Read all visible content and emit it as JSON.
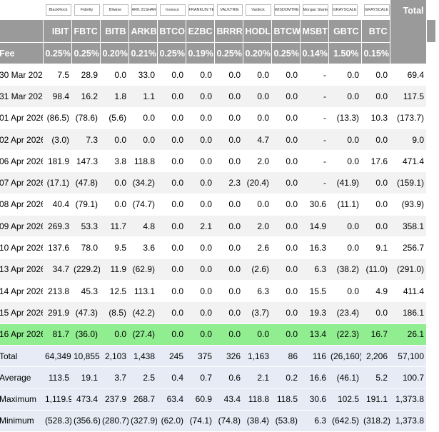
{
  "table": {
    "logos": [
      {
        "name": "blackrock-logo",
        "text": "BlackRock"
      },
      {
        "name": "fidelity-logo",
        "text": "Fidelity"
      },
      {
        "name": "bitwise-logo",
        "text": "Bitwise"
      },
      {
        "name": "ark-logo",
        "text": "ARK 21SHARES"
      },
      {
        "name": "invesco-logo",
        "text": "Invesco"
      },
      {
        "name": "franklin-logo",
        "text": "FRANKLIN TEMPLETON"
      },
      {
        "name": "valkyrie-logo",
        "text": "VALKYRIE"
      },
      {
        "name": "vaneck-logo",
        "text": "VanEck"
      },
      {
        "name": "wisdomtree-logo",
        "text": "WISDOMTREE"
      },
      {
        "name": "morgan-stanley-logo",
        "text": "Morgan Stanley"
      },
      {
        "name": "grayscale-logo-1",
        "text": "GRAYSCALE"
      },
      {
        "name": "grayscale-logo-2",
        "text": "GRAYSCALE"
      }
    ],
    "total_header": "Total",
    "tickers": [
      "IBIT",
      "FBTC",
      "BITB",
      "ARKB",
      "BTCO",
      "EZBC",
      "BRRR",
      "HODL",
      "BTCW",
      "MSBT",
      "GBTC",
      "BTC"
    ],
    "fee_label": "Fee",
    "fees": [
      "0.25%",
      "0.25%",
      "0.20%",
      "0.21%",
      "0.25%",
      "0.19%",
      "0.25%",
      "0.20%",
      "0.25%",
      "0.14%",
      "1.50%",
      "0.15%"
    ],
    "rows": [
      {
        "date": "30 Mar 2026",
        "values": [
          "7.5",
          "28.9",
          "0.0",
          "33.0",
          "0.0",
          "0.0",
          "0.0",
          "0.0",
          "0.0",
          "-",
          "0.0",
          "0.0"
        ],
        "total": "69.4"
      },
      {
        "date": "31 Mar 2026",
        "values": [
          "98.4",
          "16.2",
          "1.8",
          "1.1",
          "0.0",
          "0.0",
          "0.0",
          "0.0",
          "0.0",
          "-",
          "0.0",
          "0.0"
        ],
        "total": "117.5"
      },
      {
        "date": "01 Apr 2026",
        "values": [
          "(86.5)",
          "(78.6)",
          "(5.6)",
          "0.0",
          "0.0",
          "0.0",
          "0.0",
          "0.0",
          "0.0",
          "-",
          "(13.3)",
          "10.3"
        ],
        "total": "(173.7)"
      },
      {
        "date": "02 Apr 2026",
        "values": [
          "(3.0)",
          "7.3",
          "0.0",
          "0.0",
          "0.0",
          "0.0",
          "0.0",
          "4.7",
          "0.0",
          "-",
          "0.0",
          "0.0"
        ],
        "total": "9.0"
      },
      {
        "date": "06 Apr 2026",
        "values": [
          "181.9",
          "147.3",
          "3.8",
          "118.8",
          "0.0",
          "0.0",
          "0.0",
          "2.0",
          "0.0",
          "-",
          "0.0",
          "17.6"
        ],
        "total": "471.4"
      },
      {
        "date": "07 Apr 2026",
        "values": [
          "(17.1)",
          "(47.8)",
          "0.0",
          "(34.2)",
          "0.0",
          "0.0",
          "2.3",
          "(20.4)",
          "0.0",
          "-",
          "(41.9)",
          "0.0"
        ],
        "total": "(159.1)"
      },
      {
        "date": "08 Apr 2026",
        "values": [
          "40.4",
          "(79.1)",
          "0.0",
          "(74.7)",
          "0.0",
          "0.0",
          "0.0",
          "0.0",
          "0.0",
          "30.6",
          "(11.1)",
          "0.0"
        ],
        "total": "(93.9)"
      },
      {
        "date": "09 Apr 2026",
        "values": [
          "269.3",
          "53.3",
          "11.7",
          "4.8",
          "0.0",
          "2.1",
          "0.0",
          "2.0",
          "0.0",
          "14.9",
          "0.0",
          "0.0"
        ],
        "total": "358.1"
      },
      {
        "date": "10 Apr 2026",
        "values": [
          "137.6",
          "78.0",
          "9.5",
          "3.6",
          "0.0",
          "0.0",
          "0.0",
          "2.6",
          "0.0",
          "16.3",
          "0.0",
          "9.1"
        ],
        "total": "256.7"
      },
      {
        "date": "13 Apr 2026",
        "values": [
          "34.7",
          "(229.2)",
          "11.9",
          "(62.9)",
          "0.0",
          "0.0",
          "0.0",
          "(2.6)",
          "0.0",
          "6.3",
          "(38.2)",
          "(11.0)"
        ],
        "total": "(291.0)"
      },
      {
        "date": "14 Apr 2026",
        "values": [
          "213.8",
          "45.3",
          "12.5",
          "113.1",
          "0.0",
          "0.0",
          "0.0",
          "6.3",
          "0.0",
          "15.5",
          "0.0",
          "4.9"
        ],
        "total": "411.4"
      },
      {
        "date": "15 Apr 2026",
        "values": [
          "291.9",
          "(47.3)",
          "(8.5)",
          "(42.2)",
          "0.0",
          "0.0",
          "0.0",
          "(3.7)",
          "0.0",
          "19.3",
          "(23.4)",
          "0.0"
        ],
        "total": "186.1"
      },
      {
        "date": "16 Apr 2026",
        "values": [
          "81.7",
          "(36.0)",
          "0.0",
          "(27.4)",
          "0.0",
          "0.0",
          "0.0",
          "0.0",
          "0.0",
          "13.4",
          "(22.3)",
          "16.7"
        ],
        "total": "26.1",
        "highlight": true
      }
    ],
    "summary": [
      {
        "label": "Total",
        "values": [
          "64,349",
          "10,855",
          "2,103",
          "1,438",
          "245",
          "375",
          "326",
          "1,163",
          "86",
          "116",
          "(26,160)",
          "2,206"
        ],
        "total": "57,100"
      },
      {
        "label": "Average",
        "values": [
          "113.5",
          "19.1",
          "3.7",
          "2.5",
          "0.4",
          "0.7",
          "0.6",
          "2.1",
          "0.2",
          "16.6",
          "(46.1)",
          "5.2"
        ],
        "total": "100.7"
      },
      {
        "label": "Maximum",
        "values": [
          "1,119.9",
          "473.4",
          "237.9",
          "268.7",
          "63.4",
          "60.9",
          "43.4",
          "118.8",
          "118.5",
          "30.6",
          "102.5",
          "191.1"
        ],
        "total": "1,373.8"
      },
      {
        "label": "Minimum",
        "values": [
          "(528.3)",
          "(356.6)",
          "(280.7)",
          "(327.9)",
          "(62.0)",
          "(74.1)",
          "(74.8)",
          "(38.4)",
          "(53.8)",
          "6.3",
          "(642.5)",
          "(318.2)"
        ],
        "total": "1,373.8"
      }
    ]
  },
  "colors": {
    "header_bg": "#9a9a9a",
    "negative_text": "#e00000",
    "highlight_row": "#90ee90",
    "summary_bg": "#e6ebf5",
    "shaded_row": "#f2f2f2"
  }
}
